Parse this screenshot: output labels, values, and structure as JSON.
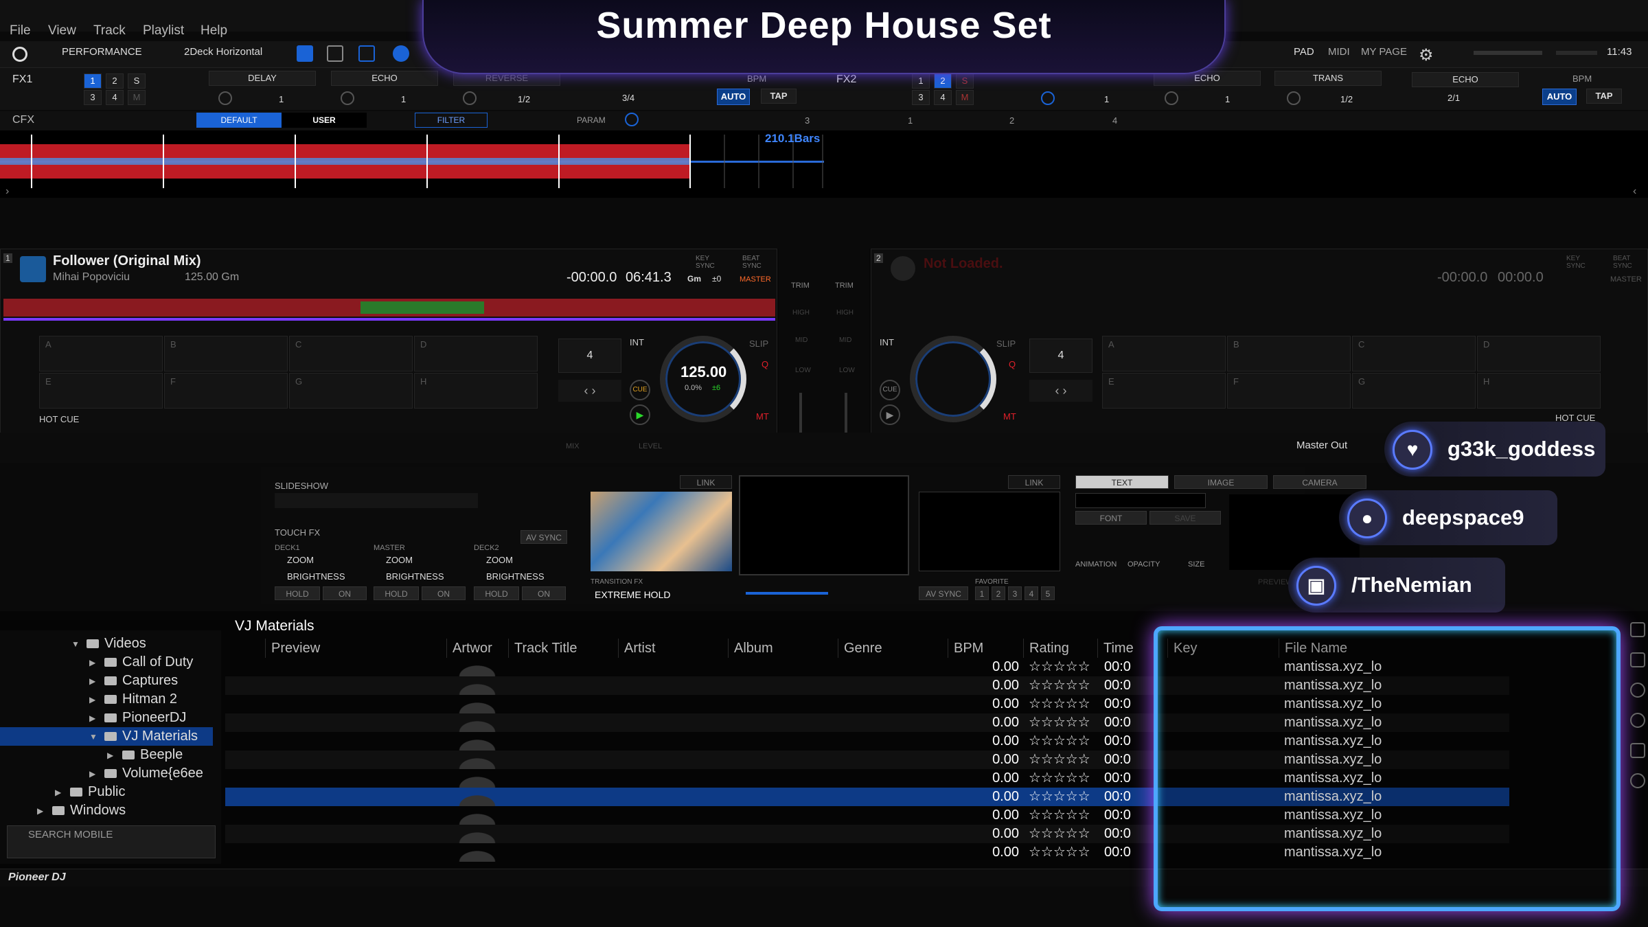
{
  "menu": {
    "items": [
      "File",
      "View",
      "Track",
      "Playlist",
      "Help"
    ]
  },
  "toolbar": {
    "mode": "PERFORMANCE",
    "layout": "2Deck Horizontal",
    "pad": "PAD",
    "midi": "MIDI",
    "mypage": "MY PAGE",
    "clock": "11:43"
  },
  "stream": {
    "title": "Summer Deep House Set"
  },
  "fx1": {
    "label": "FX1",
    "slots": [
      "1",
      "2",
      "S",
      "3",
      "4",
      "M"
    ],
    "effects": [
      "DELAY",
      "ECHO",
      "REVERSE"
    ],
    "values": [
      "1",
      "1",
      "1/2"
    ],
    "beat": "3/4",
    "bpm_label": "BPM",
    "auto": "AUTO",
    "tap": "TAP"
  },
  "fx2": {
    "label": "FX2",
    "slots": [
      "1",
      "2",
      "S",
      "3",
      "4",
      "M"
    ],
    "effects": [
      "ECHO",
      "TRANS",
      "ECHO"
    ],
    "values": [
      "1",
      "1",
      "1/2"
    ],
    "beat": "2/1",
    "bpm_label": "BPM",
    "auto": "AUTO",
    "tap": "TAP"
  },
  "cfx": {
    "label": "CFX",
    "tabs": [
      "DEFAULT",
      "USER"
    ],
    "filter": "FILTER",
    "param": "PARAM",
    "values": [
      "3",
      "1",
      "2",
      "4"
    ]
  },
  "overview": {
    "bars": "210.1Bars"
  },
  "deck1": {
    "num": "1",
    "title": "Follower (Original Mix)",
    "artist": "Mihai Popoviciu",
    "bpm": "125.00 Gm",
    "time_remaining": "-00:00.0",
    "time_total": "06:41.3",
    "key_sync": "KEY SYNC",
    "beat_sync": "BEAT SYNC",
    "master": "MASTER",
    "key": "Gm",
    "key_offset": "±0",
    "pads": [
      "A",
      "B",
      "C",
      "D",
      "E",
      "F",
      "G",
      "H"
    ],
    "hotcue": "HOT CUE",
    "beat_count": "4",
    "int": "INT",
    "slip": "SLIP",
    "q": "Q",
    "mt": "MT",
    "cue": "CUE",
    "jog_bpm": "125.00",
    "jog_pct": "0.0%",
    "jog_range": "±6"
  },
  "deck2": {
    "num": "2",
    "title": "Not Loaded.",
    "time_remaining": "-00:00.0",
    "time_total": "00:00.0",
    "key_sync": "KEY SYNC",
    "beat_sync": "BEAT SYNC",
    "master": "MASTER",
    "pads": [
      "A",
      "B",
      "C",
      "D",
      "E",
      "F",
      "G",
      "H"
    ],
    "hotcue": "HOT CUE",
    "beat_count": "4",
    "int": "INT",
    "slip": "SLIP",
    "q": "Q",
    "mt": "MT",
    "cue": "CUE"
  },
  "mixer": {
    "trim": "TRIM",
    "high": "HIGH",
    "mid": "MID",
    "low": "LOW",
    "mix": "MIX",
    "level": "LEVEL",
    "master_out": "Master Out"
  },
  "vj": {
    "slideshow": "SLIDESHOW",
    "link": "LINK",
    "touch_fx": "TOUCH FX",
    "av_sync": "AV SYNC",
    "deck1": "DECK1",
    "master": "MASTER",
    "deck2": "DECK2",
    "x": "ZOOM",
    "y": "BRIGHTNESS",
    "hold": "HOLD",
    "on": "ON",
    "transition_fx": "TRANSITION FX",
    "transition": "EXTREME HOLD",
    "favorite": "FAVORITE",
    "fav": [
      "1",
      "2",
      "3",
      "4",
      "5"
    ],
    "tabs": [
      "TEXT",
      "IMAGE",
      "CAMERA"
    ],
    "font": "FONT",
    "save": "SAVE",
    "animation": "ANIMATION",
    "opacity": "OPACITY",
    "size": "SIZE",
    "preview": "PREVIEW",
    "avsync2": "AV SYNC"
  },
  "tree": {
    "items": [
      {
        "label": "Videos",
        "level": 2,
        "open": true
      },
      {
        "label": "Call of Duty",
        "level": 3
      },
      {
        "label": "Captures",
        "level": 3
      },
      {
        "label": "Hitman 2",
        "level": 3
      },
      {
        "label": "PioneerDJ",
        "level": 3
      },
      {
        "label": "VJ Materials",
        "level": 3,
        "open": true,
        "selected": true
      },
      {
        "label": "Beeple",
        "level": 4
      },
      {
        "label": "Volume{e6ee",
        "level": 3
      },
      {
        "label": "Public",
        "level": 1
      },
      {
        "label": "Windows",
        "level": 0
      }
    ],
    "search_mobile": "SEARCH MOBILE"
  },
  "table": {
    "title": "VJ Materials",
    "columns": [
      "Preview",
      "Artwor",
      "Track Title",
      "Artist",
      "Album",
      "Genre",
      "BPM",
      "Rating",
      "Time",
      "Key",
      "File Name"
    ],
    "rows": [
      {
        "bpm": "0.00",
        "rating": "☆☆☆☆☆",
        "time": "00:0",
        "file": "mantissa.xyz_lo"
      },
      {
        "bpm": "0.00",
        "rating": "☆☆☆☆☆",
        "time": "00:0",
        "file": "mantissa.xyz_lo"
      },
      {
        "bpm": "0.00",
        "rating": "☆☆☆☆☆",
        "time": "00:0",
        "file": "mantissa.xyz_lo"
      },
      {
        "bpm": "0.00",
        "rating": "☆☆☆☆☆",
        "time": "00:0",
        "file": "mantissa.xyz_lo"
      },
      {
        "bpm": "0.00",
        "rating": "☆☆☆☆☆",
        "time": "00:0",
        "file": "mantissa.xyz_lo"
      },
      {
        "bpm": "0.00",
        "rating": "☆☆☆☆☆",
        "time": "00:0",
        "file": "mantissa.xyz_lo"
      },
      {
        "bpm": "0.00",
        "rating": "☆☆☆☆☆",
        "time": "00:0",
        "file": "mantissa.xyz_lo"
      },
      {
        "bpm": "0.00",
        "rating": "☆☆☆☆☆",
        "time": "00:0",
        "file": "mantissa.xyz_lo"
      },
      {
        "bpm": "0.00",
        "rating": "☆☆☆☆☆",
        "time": "00:0",
        "file": "mantissa.xyz_lo"
      },
      {
        "bpm": "0.00",
        "rating": "☆☆☆☆☆",
        "time": "00:0",
        "file": "mantissa.xyz_lo"
      },
      {
        "bpm": "0.00",
        "rating": "☆☆☆☆☆",
        "time": "00:0",
        "file": "mantissa.xyz_lo"
      }
    ],
    "selected_index": 7
  },
  "footer": {
    "brand": "Pioneer DJ"
  },
  "socials": [
    {
      "icon": "heart-icon",
      "glyph": "♥",
      "name": "g33k_goddess"
    },
    {
      "icon": "user-icon",
      "glyph": "●",
      "name": "deepspace9"
    },
    {
      "icon": "twitch-icon",
      "glyph": "▣",
      "name": "/TheNemian"
    }
  ],
  "colors": {
    "accent": "#1a63d6",
    "waveform": "#e0202a",
    "selected_row": "#0d3a86",
    "neon": "#a64dff"
  }
}
